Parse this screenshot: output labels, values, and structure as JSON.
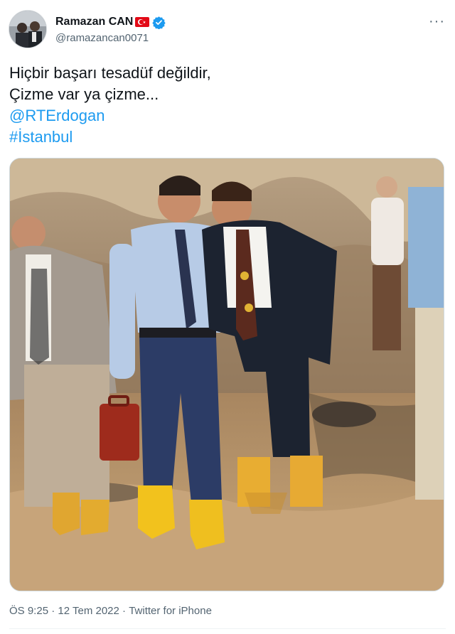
{
  "user": {
    "display_name": "Ramazan CAN",
    "handle": "@ramazancan0071",
    "flag_icon": "turkey-flag-icon",
    "verified_icon": "verified-badge-icon"
  },
  "more_label": "···",
  "tweet": {
    "line1": "Hiçbir başarı tesadüf değildir,",
    "line2": "Çizme var ya çizme...",
    "mention": "@RTErdogan",
    "hashtag": "#İstanbul"
  },
  "meta": {
    "time": "ÖS 9:25",
    "separator1": " · ",
    "date": "12 Tem 2022",
    "separator2": " · ",
    "source": "Twitter for iPhone"
  },
  "colors": {
    "link": "#1d9bf0",
    "secondary_text": "#536471",
    "verified": "#1d9bf0",
    "flag": "#e30a17"
  }
}
